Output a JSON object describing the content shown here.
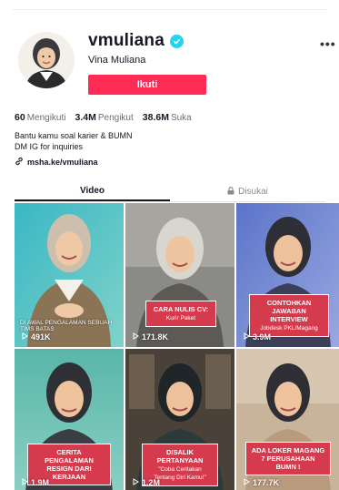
{
  "profile": {
    "username": "vmuliana",
    "display_name": "Vina Muliana",
    "follow_label": "Ikuti",
    "more_label": "•••",
    "avatar_icon": "avatar-photo-icon",
    "verified_icon": "verified-check-icon"
  },
  "stats": [
    {
      "value": "60",
      "label": "Mengikuti"
    },
    {
      "value": "3.4M",
      "label": "Pengikut"
    },
    {
      "value": "38.6M",
      "label": "Suka"
    }
  ],
  "bio": {
    "line1": "Bantu kamu soal karier & BUMN",
    "line2": "DM IG for inquiries",
    "link": "msha.ke/vmuliana",
    "link_icon": "link-icon"
  },
  "tabs": {
    "video": "Video",
    "liked": "Disukai",
    "liked_icon": "lock-icon"
  },
  "videos": [
    {
      "views": "491K",
      "caption": "",
      "caption_sub": "",
      "overlay_text": "DI AWAL PENGALAMAN SEBUAH TIMS BATAS"
    },
    {
      "views": "171.8K",
      "caption": "CARA NULIS CV:",
      "caption_sub": "Kurir Paket",
      "overlay_text": ""
    },
    {
      "views": "3.9M",
      "caption": "CONTOHKAN JAWABAN INTERVIEW",
      "caption_sub": "Jobdesk PKL/Magang",
      "overlay_text": ""
    },
    {
      "views": "1.9M",
      "caption": "CERITA PENGALAMAN RESIGN DARI KERJAAN",
      "caption_sub": "",
      "overlay_text": ""
    },
    {
      "views": "1.2M",
      "caption": "DISALIK PERTANYAAN",
      "caption_sub": "\"Coba Ceritakan Tentang Diri Kamu!\"",
      "overlay_text": ""
    },
    {
      "views": "177.7K",
      "caption": "ADA LOKER MAGANG 7 PERUSAHAAN BUMN !",
      "caption_sub": "",
      "overlay_text": ""
    }
  ],
  "colors": {
    "accent": "#fe2c55",
    "verified": "#20d5ec",
    "caption_bg": "#d63a4d",
    "text": "#161823",
    "muted": "#6b6c72"
  }
}
